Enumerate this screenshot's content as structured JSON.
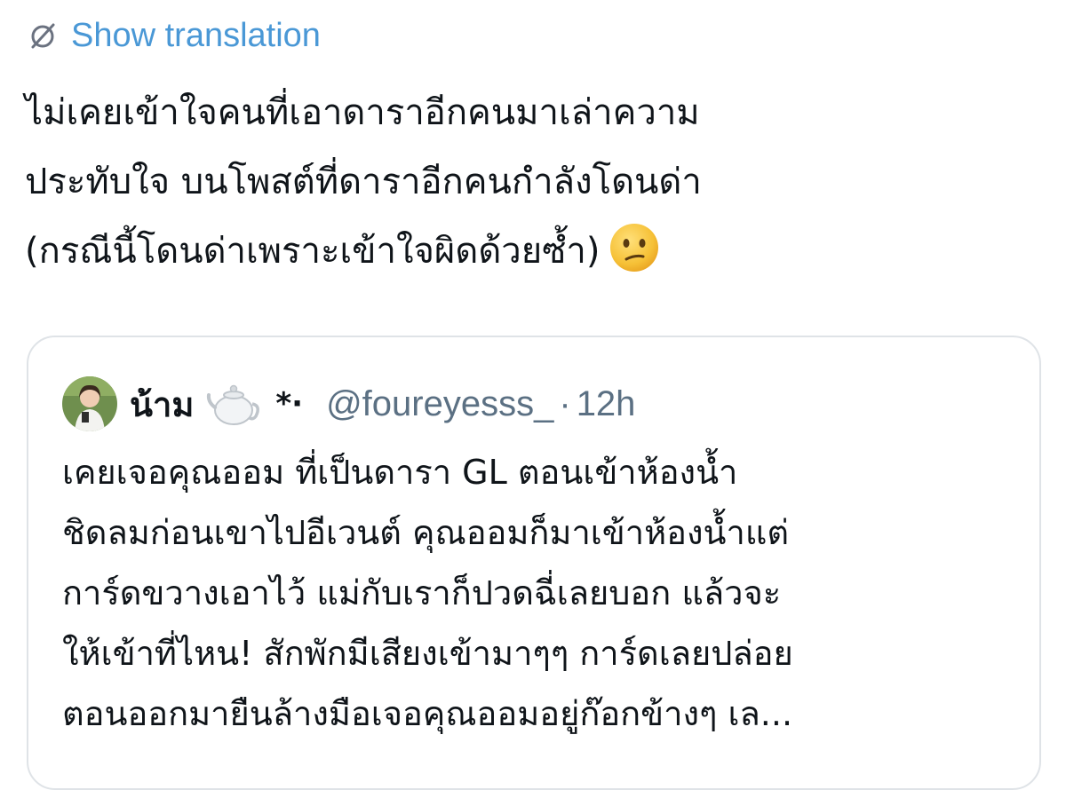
{
  "translate": {
    "icon": "globe-slash-icon",
    "label": "Show translation"
  },
  "tweet": {
    "text": "ไม่เคยเข้าใจคนที่เอาดาราอีกคนมาเล่าความ\nประทับใจ บนโพสต์ที่ดาราอีกคนกำลังโดนด่า\n(กรณีนี้โดนด่าเพราะเข้าใจผิดด้วยซ้ำ)",
    "emoji": "confused-face-emoji"
  },
  "quoted_tweet": {
    "avatar": "avatar",
    "display_name": "น้าม",
    "name_emoji": "teapot-icon",
    "name_suffix": "*·",
    "handle": "@foureyesss_",
    "separator": "·",
    "timestamp": "12h",
    "text": "เคยเจอคุณออม ที่เป็นดารา GL ตอนเข้าห้องน้ำ\nชิดลมก่อนเขาไปอีเวนต์ คุณออมก็มาเข้าห้องน้ำแต่\nการ์ดขวางเอาไว้ แม่กับเราก็ปวดฉี่เลยบอก แล้วจะ\nให้เข้าที่ไหน! สักพักมีเสียงเข้ามาๆๆ การ์ดเลยปล่อย\nตอนออกมายืนล้างมือเจอคุณออมอยู่ก๊อกข้างๆ เล..."
  },
  "colors": {
    "link": "#4a98d6",
    "text": "#0f1419",
    "muted": "#5b7083",
    "border": "#dfe3e7"
  }
}
